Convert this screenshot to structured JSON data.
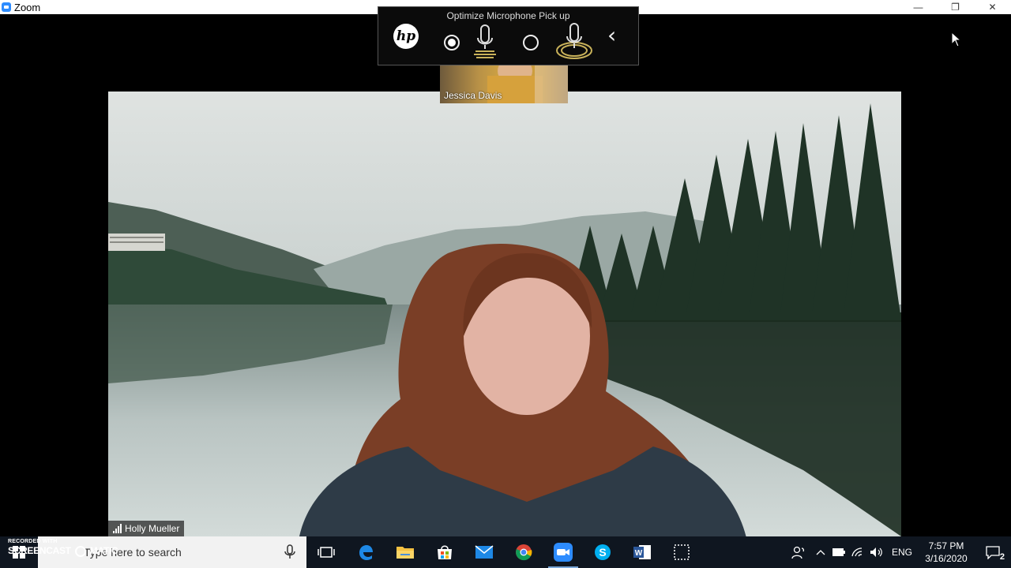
{
  "window": {
    "title": "Zoom",
    "controls": {
      "minimize": "—",
      "restore": "❐",
      "close": "✕"
    }
  },
  "hp_toolbar": {
    "title": "Optimize Microphone Pick up",
    "logo_text": "hp",
    "options": [
      {
        "icon": "directional-microphone-icon",
        "selected": true
      },
      {
        "icon": "omnidirectional-microphone-icon",
        "selected": false
      }
    ],
    "collapse_icon": "chevron-left-icon"
  },
  "participants": {
    "thumbnail": {
      "name": "Jessica Davis"
    },
    "active_speaker": {
      "name": "Holly Mueller"
    }
  },
  "taskbar": {
    "search": {
      "placeholder": "Type here to search"
    },
    "apps": [
      {
        "name": "task-view",
        "icon": "task-view-icon"
      },
      {
        "name": "edge",
        "icon": "edge-icon"
      },
      {
        "name": "file-explorer",
        "icon": "folder-icon"
      },
      {
        "name": "store",
        "icon": "store-icon"
      },
      {
        "name": "mail",
        "icon": "mail-icon"
      },
      {
        "name": "chrome",
        "icon": "chrome-icon"
      },
      {
        "name": "zoom",
        "icon": "zoom-icon",
        "active": true
      },
      {
        "name": "skype",
        "icon": "skype-icon"
      },
      {
        "name": "word",
        "icon": "word-icon"
      },
      {
        "name": "snipping",
        "icon": "screen-snip-icon"
      }
    ],
    "tray": {
      "language": "ENG",
      "time": "7:57 PM",
      "date": "3/16/2020",
      "notifications": "2"
    }
  },
  "watermark": {
    "line1": "RECORDED WITH",
    "line2": "SCREENCAST",
    "line3": "MATIC"
  },
  "colors": {
    "accent": "#2d8cff",
    "taskbar": "#0f1620",
    "background": "#000000"
  }
}
